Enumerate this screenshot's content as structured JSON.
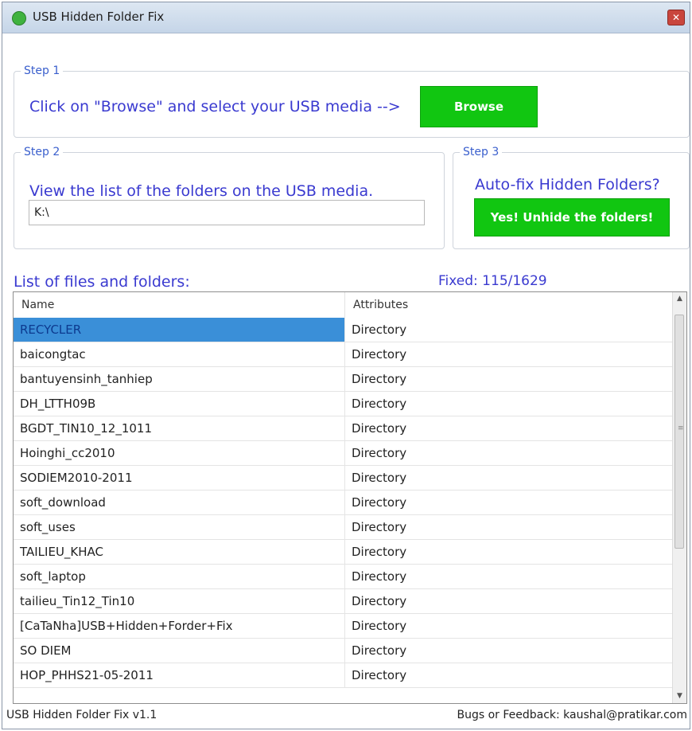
{
  "window": {
    "title": "USB Hidden Folder Fix",
    "close_glyph": "✕"
  },
  "step1": {
    "legend": "Step 1",
    "instruction": "Click on \"Browse\" and select your USB media -->",
    "browse_label": "Browse"
  },
  "step2": {
    "legend": "Step 2",
    "instruction": "View the list of the folders on the USB media.",
    "path_value": "K:\\"
  },
  "step3": {
    "legend": "Step 3",
    "question": "Auto-fix Hidden Folders?",
    "unhide_label": "Yes! Unhide the folders!"
  },
  "list": {
    "caption": "List of files and folders:",
    "fixed": "Fixed: 115/1629",
    "columns": {
      "name": "Name",
      "attributes": "Attributes"
    },
    "rows": [
      {
        "name": "RECYCLER",
        "attr": "Directory"
      },
      {
        "name": "baicongtac",
        "attr": "Directory"
      },
      {
        "name": "bantuyensinh_tanhiep",
        "attr": "Directory"
      },
      {
        "name": "DH_LTTH09B",
        "attr": "Directory"
      },
      {
        "name": "BGDT_TIN10_12_1011",
        "attr": "Directory"
      },
      {
        "name": "Hoinghi_cc2010",
        "attr": "Directory"
      },
      {
        "name": "SODIEM2010-2011",
        "attr": "Directory"
      },
      {
        "name": "soft_download",
        "attr": "Directory"
      },
      {
        "name": "soft_uses",
        "attr": "Directory"
      },
      {
        "name": "TAILIEU_KHAC",
        "attr": "Directory"
      },
      {
        "name": "soft_laptop",
        "attr": "Directory"
      },
      {
        "name": "tailieu_Tin12_Tin10",
        "attr": "Directory"
      },
      {
        "name": "[CaTaNha]USB+Hidden+Forder+Fix",
        "attr": "Directory"
      },
      {
        "name": "SO DIEM",
        "attr": "Directory"
      },
      {
        "name": "HOP_PHHS21-05-2011",
        "attr": "Directory"
      }
    ],
    "selected_index": 0
  },
  "status": {
    "version": "USB Hidden Folder Fix v1.1",
    "feedback": "Bugs or Feedback: kaushal@pratikar.com"
  },
  "colors": {
    "accent_green": "#11c611",
    "label_blue": "#3a3ad0",
    "selection_blue": "#3a8fd8"
  },
  "icons": {
    "app": "usb-fix-app-icon",
    "close": "close-icon",
    "scroll_up": "chevron-up-icon",
    "scroll_down": "chevron-down-icon"
  }
}
